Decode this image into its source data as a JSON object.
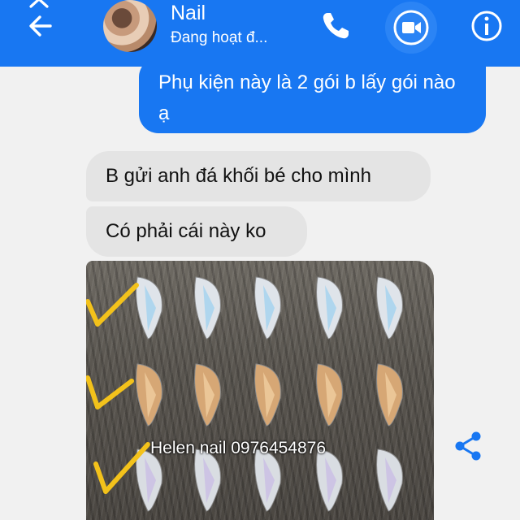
{
  "header": {
    "contact_name": "Nail",
    "status": "Đang hoạt đ...",
    "colors": {
      "bar": "#1877f2",
      "icon": "#ffffff"
    },
    "icons": [
      "close-icon",
      "back-arrow-icon",
      "phone-icon",
      "video-camera-icon",
      "info-icon"
    ]
  },
  "messages": [
    {
      "direction": "outgoing",
      "text": "Phụ kiện này là 2 gói b lấy gói nào ạ"
    },
    {
      "direction": "incoming",
      "text": "B gửi anh đá khối bé cho mình"
    },
    {
      "direction": "incoming",
      "text": "Có phải cái này ko"
    },
    {
      "direction": "incoming",
      "type": "image",
      "watermark": "Helen nail 0976454876"
    }
  ],
  "share": {
    "icon": "share-icon"
  }
}
